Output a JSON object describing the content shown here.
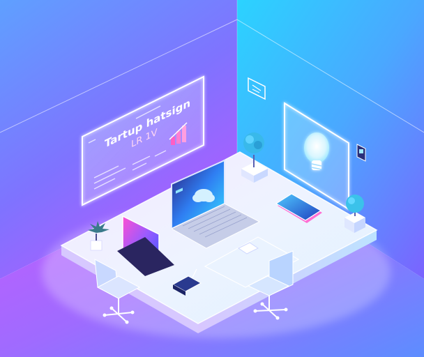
{
  "scene": {
    "left_panel": {
      "heading": "Tartup hatsign",
      "subheading": "LR 1V"
    }
  },
  "colors": {
    "wall_left_top": "#6a8bff",
    "wall_left_bottom": "#a45cff",
    "wall_right_top": "#2fd0ff",
    "wall_right_bottom": "#7a5cff",
    "floor": "#b06bff",
    "platform_top": "#eaf0ff",
    "glow_white": "#ffffff",
    "accent_pink": "#ff5ec4",
    "accent_cyan": "#37e6ff",
    "plant_cyan": "#39c7f0"
  }
}
